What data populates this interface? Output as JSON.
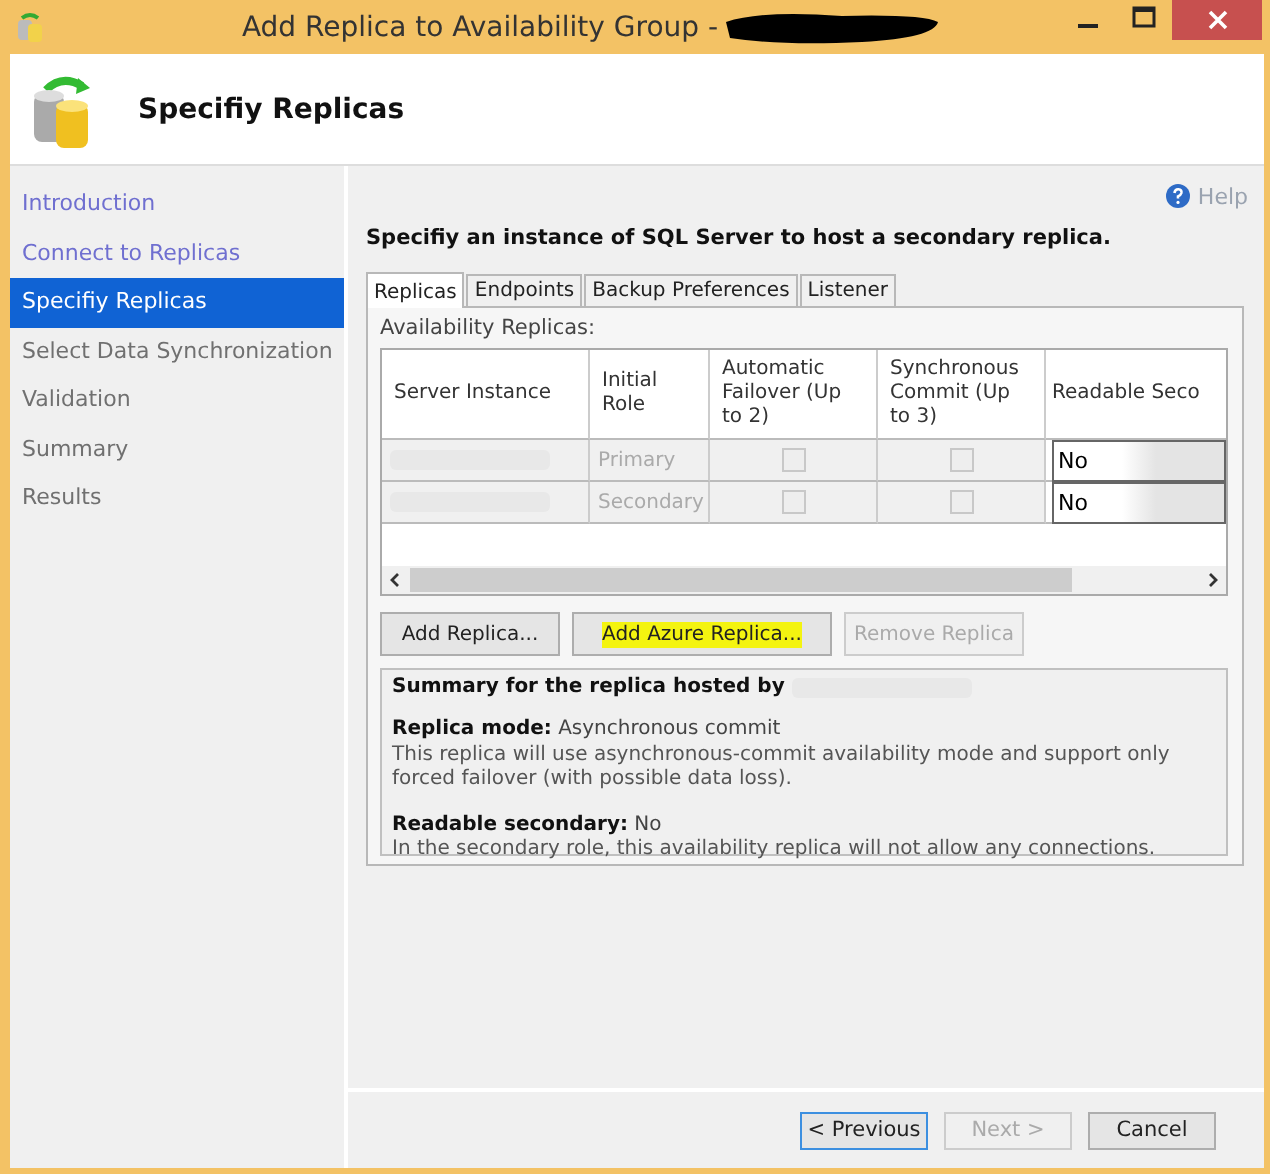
{
  "window": {
    "title": "Add Replica to Availability Group -"
  },
  "header": {
    "title": "Specifiy Replicas"
  },
  "sidebar": {
    "items": [
      {
        "label": "Introduction",
        "visited": true,
        "selected": false
      },
      {
        "label": "Connect to Replicas",
        "visited": true,
        "selected": false
      },
      {
        "label": "Specifiy Replicas",
        "visited": true,
        "selected": true
      },
      {
        "label": "Select Data Synchronization",
        "visited": false,
        "selected": false
      },
      {
        "label": "Validation",
        "visited": false,
        "selected": false
      },
      {
        "label": "Summary",
        "visited": false,
        "selected": false
      },
      {
        "label": "Results",
        "visited": false,
        "selected": false
      }
    ]
  },
  "help": {
    "label": "Help"
  },
  "instruction": "Specifiy an instance of SQL Server to host a secondary replica.",
  "tabs": [
    {
      "label": "Replicas",
      "selected": true
    },
    {
      "label": "Endpoints",
      "selected": false
    },
    {
      "label": "Backup Preferences",
      "selected": false
    },
    {
      "label": "Listener",
      "selected": false
    }
  ],
  "group_label": "Availability Replicas:",
  "table": {
    "columns": [
      "Server Instance",
      "Initial Role",
      "Automatic Failover (Up to 2)",
      "Synchronous Commit (Up to 3)",
      "Readable Seco"
    ],
    "rows": [
      {
        "role": "Primary",
        "automatic_failover": false,
        "synchronous_commit": false,
        "readable": "No"
      },
      {
        "role": "Secondary",
        "automatic_failover": false,
        "synchronous_commit": false,
        "readable": "No"
      }
    ]
  },
  "buttons": [
    {
      "label": "Add Replica...",
      "disabled": false,
      "highlighted": false
    },
    {
      "label": "Add Azure Replica...",
      "disabled": false,
      "highlighted": true
    },
    {
      "label": "Remove Replica",
      "disabled": true,
      "highlighted": false
    }
  ],
  "summary": {
    "title": "Summary for the replica hosted by",
    "sections": [
      {
        "label": "Replica mode:",
        "value": "Asynchronous commit",
        "description": "This replica will use asynchronous-commit availability mode and support only forced failover (with possible data loss)."
      },
      {
        "label": "Readable secondary:",
        "value": "No",
        "description": "In the secondary role, this availability replica will not allow any connections."
      }
    ]
  },
  "footer": [
    {
      "label": "< Previous",
      "disabled": false,
      "default": true
    },
    {
      "label": "Next >",
      "disabled": true,
      "default": false
    },
    {
      "label": "Cancel",
      "disabled": false,
      "default": false
    }
  ]
}
